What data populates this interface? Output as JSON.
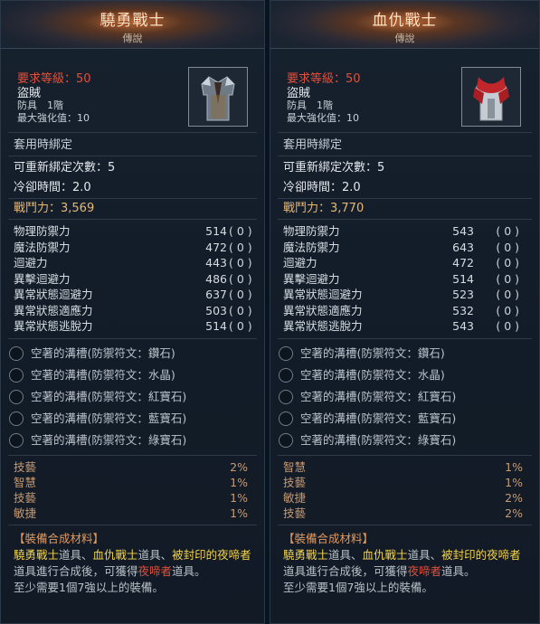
{
  "items": [
    {
      "name": "驍勇戰士",
      "grade": "傳說",
      "requirement": "要求等級：50",
      "class": "盜賊",
      "armor_type": "防具　1階",
      "max_enhance": "最大強化值：10",
      "bind": "套用時綁定",
      "rebind": "可重新綁定次數：5",
      "cooldown": "冷卻時間：2.0",
      "power": "戰鬥力：3,569",
      "stats": [
        {
          "label": "物理防禦力",
          "value": "514",
          "bonus": "( 0 )"
        },
        {
          "label": "魔法防禦力",
          "value": "472",
          "bonus": "( 0 )"
        },
        {
          "label": "迴避力",
          "value": "443",
          "bonus": "( 0 )"
        },
        {
          "label": "異擊迴避力",
          "value": "486",
          "bonus": "( 0 )"
        },
        {
          "label": "異常狀態迴避力",
          "value": "637",
          "bonus": "( 0 )"
        },
        {
          "label": "異常狀態適應力",
          "value": "503",
          "bonus": "( 0 )"
        },
        {
          "label": "異常狀態逃脫力",
          "value": "514",
          "bonus": "( 0 )"
        }
      ],
      "sockets": [
        "空著的溝槽(防禦符文：鑽石)",
        "空著的溝槽(防禦符文：水晶)",
        "空著的溝槽(防禦符文：紅寶石)",
        "空著的溝槽(防禦符文：藍寶石)",
        "空著的溝槽(防禦符文：綠寶石)"
      ],
      "gems": [
        {
          "label": "技藝",
          "pct": "2%"
        },
        {
          "label": "智慧",
          "pct": "1%"
        },
        {
          "label": "技藝",
          "pct": "1%"
        },
        {
          "label": "敏捷",
          "pct": "1%"
        }
      ],
      "craft": {
        "title": "【裝備合成材料】",
        "item1": "驍勇戰士",
        "item2": "血仇戰士",
        "sealed": "被封印的夜啼者",
        "word_item": "道具",
        "sep": "、",
        "text_mid": "道具進行合成後，可獲得",
        "result": "夜啼者",
        "end_dot": "道具。",
        "line3": "至少需要1個7強以上的裝備。"
      }
    },
    {
      "name": "血仇戰士",
      "grade": "傳說",
      "requirement": "要求等級：50",
      "class": "盜賊",
      "armor_type": "防具　1階",
      "max_enhance": "最大強化值：10",
      "bind": "套用時綁定",
      "rebind": "可重新綁定次數：5",
      "cooldown": "冷卻時間：2.0",
      "power": "戰鬥力：3,770",
      "stats": [
        {
          "label": "物理防禦力",
          "value": "543",
          "bonus": "( 0 )"
        },
        {
          "label": "魔法防禦力",
          "value": "643",
          "bonus": "( 0 )"
        },
        {
          "label": "迴避力",
          "value": "472",
          "bonus": "( 0 )"
        },
        {
          "label": "異擊迴避力",
          "value": "514",
          "bonus": "( 0 )"
        },
        {
          "label": "異常狀態迴避力",
          "value": "523",
          "bonus": "( 0 )"
        },
        {
          "label": "異常狀態適應力",
          "value": "532",
          "bonus": "( 0 )"
        },
        {
          "label": "異常狀態逃脫力",
          "value": "543",
          "bonus": "( 0 )"
        }
      ],
      "sockets": [
        "空著的溝槽(防禦符文：鑽石)",
        "空著的溝槽(防禦符文：水晶)",
        "空著的溝槽(防禦符文：紅寶石)",
        "空著的溝槽(防禦符文：藍寶石)",
        "空著的溝槽(防禦符文：綠寶石)"
      ],
      "gems": [
        {
          "label": "智慧",
          "pct": "1%"
        },
        {
          "label": "技藝",
          "pct": "1%"
        },
        {
          "label": "敏捷",
          "pct": "2%"
        },
        {
          "label": "技藝",
          "pct": "2%"
        }
      ],
      "craft": {
        "title": "【裝備合成材料】",
        "item1": "驍勇戰士",
        "item2": "血仇戰士",
        "sealed": "被封印的夜啼者",
        "word_item": "道具",
        "sep": "、",
        "text_mid": "道具進行合成後，可獲得",
        "result": "夜啼者",
        "end_dot": "道具。",
        "line3": "至少需要1個7強以上的裝備。"
      }
    }
  ]
}
